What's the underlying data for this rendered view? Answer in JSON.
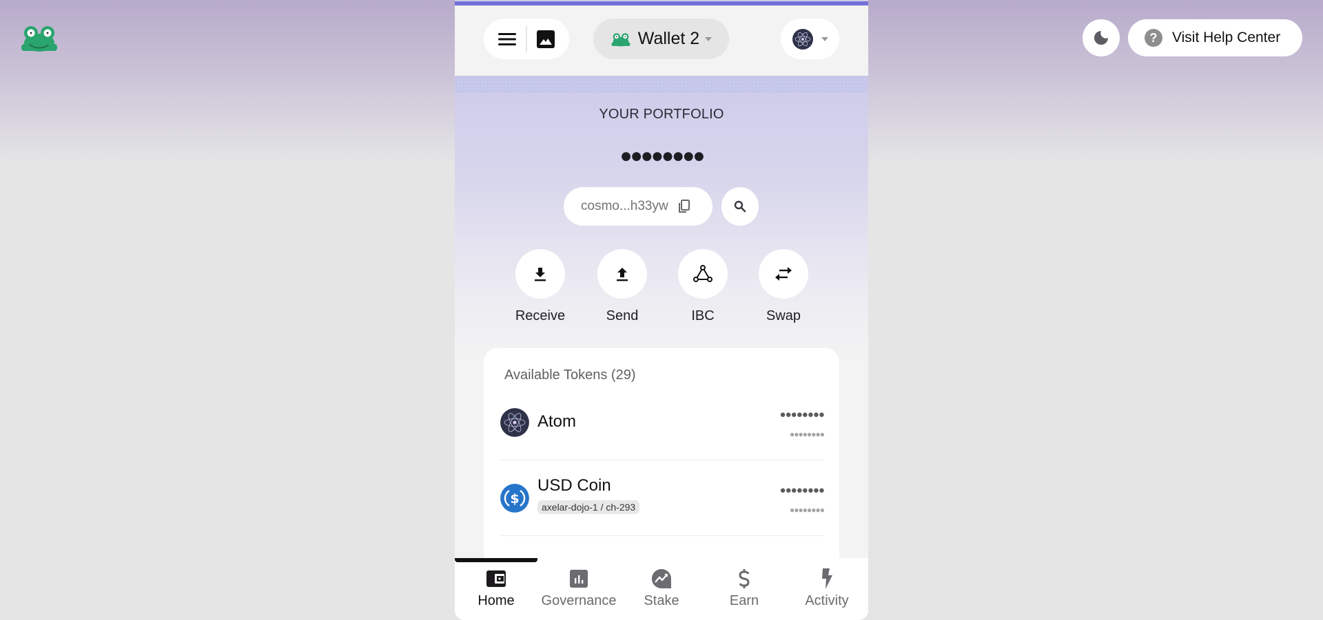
{
  "top_controls": {
    "theme_toggle_icon": "moon-icon",
    "help_button_label": "Visit Help Center",
    "help_icon": "question-icon"
  },
  "header": {
    "menu_icon": "hamburger-icon",
    "gallery_icon": "image-icon",
    "wallet_name": "Wallet 2",
    "wallet_icon": "frog-icon",
    "chain_icon": "cosmos-hub-icon"
  },
  "portfolio": {
    "label": "YOUR PORTFOLIO",
    "balance_hidden": "●●●●●●●●",
    "address": "cosmo...h33yw",
    "copy_icon": "copy-icon",
    "search_icon": "search-icon"
  },
  "actions": [
    {
      "label": "Receive",
      "icon": "download-icon"
    },
    {
      "label": "Send",
      "icon": "upload-icon"
    },
    {
      "label": "IBC",
      "icon": "ibc-triangle-icon"
    },
    {
      "label": "Swap",
      "icon": "swap-arrows-icon"
    }
  ],
  "tokens": {
    "title": "Available Tokens (29)",
    "items": [
      {
        "name": "Atom",
        "badge": null,
        "amount_hidden": "●●●●●●●●",
        "value_hidden": "●●●●●●●●",
        "icon": "atom-icon"
      },
      {
        "name": "USD Coin",
        "badge": "axelar-dojo-1 / ch-293",
        "amount_hidden": "●●●●●●●●",
        "value_hidden": "●●●●●●●●",
        "icon": "usdc-icon"
      }
    ]
  },
  "bottom_nav": {
    "active": "Home",
    "items": [
      {
        "label": "Home",
        "icon": "wallet-icon"
      },
      {
        "label": "Governance",
        "icon": "bar-chart-icon"
      },
      {
        "label": "Stake",
        "icon": "trending-up-icon"
      },
      {
        "label": "Earn",
        "icon": "dollar-icon"
      },
      {
        "label": "Activity",
        "icon": "lightning-icon"
      }
    ]
  },
  "colors": {
    "accent": "#7471d9",
    "frog_green": "#2aa56f",
    "usdc_blue": "#2775ca",
    "atom_dark": "#2e3148"
  }
}
